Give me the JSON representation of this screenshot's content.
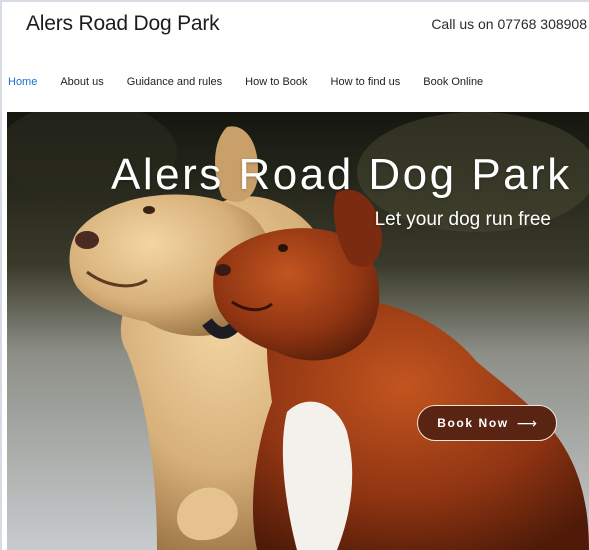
{
  "header": {
    "site_title": "Alers Road Dog Park",
    "phone_text": "Call us on 07768 308908"
  },
  "nav": {
    "items": [
      {
        "label": "Home",
        "active": true
      },
      {
        "label": "About us",
        "active": false
      },
      {
        "label": "Guidance and rules",
        "active": false
      },
      {
        "label": "How to Book",
        "active": false
      },
      {
        "label": "How to find us",
        "active": false
      },
      {
        "label": "Book Online",
        "active": false
      }
    ]
  },
  "hero": {
    "title": "Alers Road Dog Park",
    "subtitle": "Let your dog run free",
    "book_button_label": "Book Now",
    "book_button_arrow": "⟶",
    "image_subject": "two-dogs-running-photo"
  },
  "colors": {
    "active_nav": "#1b6fd9",
    "button_fill": "#5a2412",
    "button_border": "#f3e3d8"
  }
}
